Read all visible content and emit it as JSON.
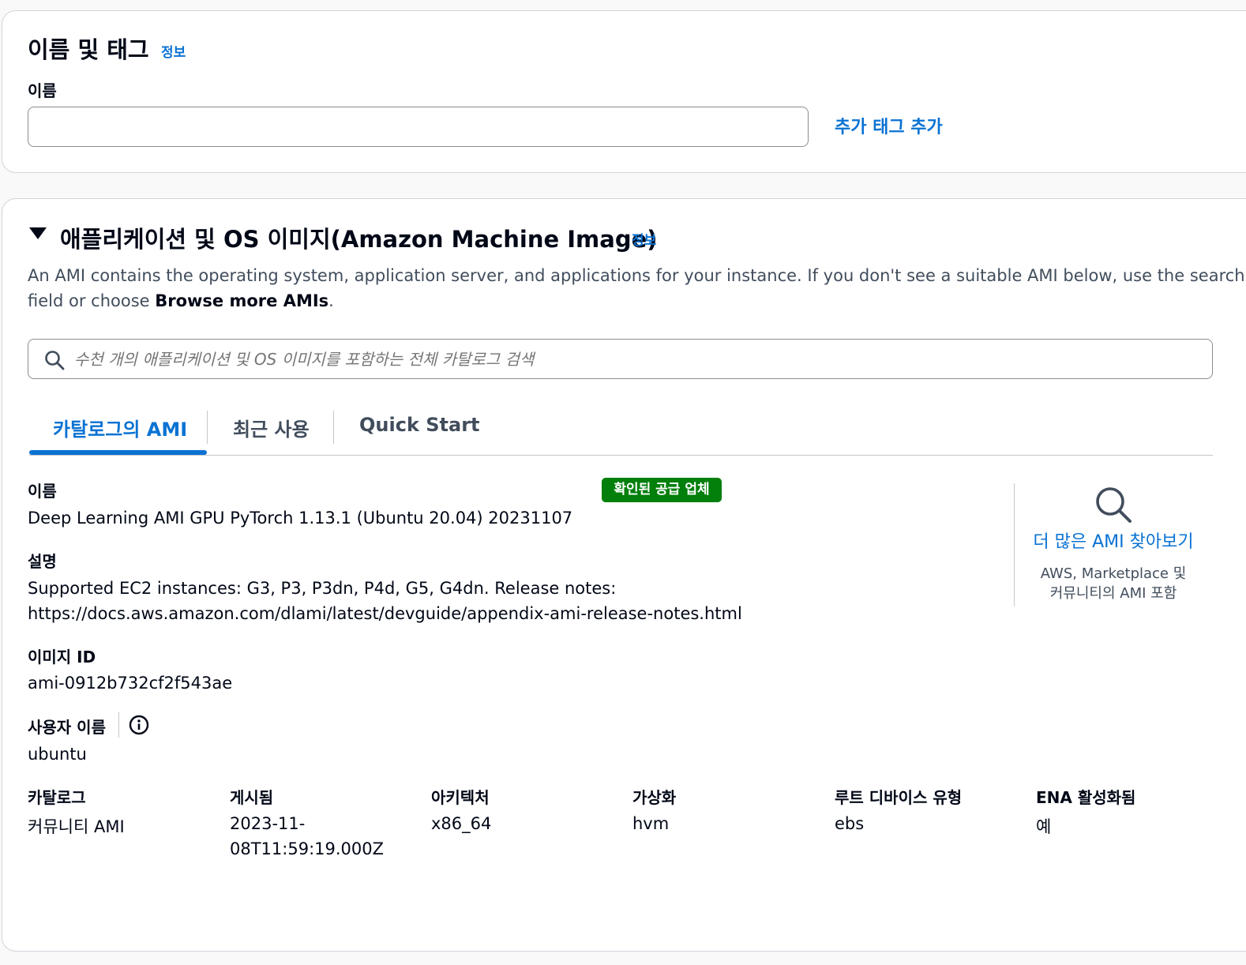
{
  "name_tags": {
    "title": "이름 및 태그",
    "info": "정보",
    "name_label": "이름",
    "name_value": "",
    "add_tag": "추가 태그 추가"
  },
  "ami_section": {
    "title": "애플리케이션 및 OS 이미지(Amazon Machine Image)",
    "info": "정보",
    "desc_part1": "An AMI contains the operating system, application server, and applications for your instance. If you don't see a suitable AMI below, use the search",
    "desc_part2": "field or choose ",
    "desc_bold": "Browse more AMIs",
    "desc_end": ".",
    "search_placeholder": "수천 개의 애플리케이션 및 OS 이미지를 포함하는 전체 카탈로그 검색",
    "tabs": [
      "카탈로그의 AMI",
      "최근 사용",
      "Quick Start"
    ],
    "active_tab": 0
  },
  "ami_details": {
    "name_label": "이름",
    "badge": "확인된 공급 업체",
    "name_value": "Deep Learning AMI GPU PyTorch 1.13.1 (Ubuntu 20.04) 20231107",
    "desc_label": "설명",
    "desc_line1": "Supported EC2 instances: G3, P3, P3dn, P4d, G5, G4dn. Release notes:",
    "desc_line2": "https://docs.aws.amazon.com/dlami/latest/devguide/appendix-ami-release-notes.html",
    "image_id_label": "이미지 ID",
    "image_id": "ami-0912b732cf2f543ae",
    "username_label": "사용자 이름",
    "username": "ubuntu",
    "meta": [
      {
        "label": "카탈로그",
        "value": "커뮤니티 AMI"
      },
      {
        "label": "게시됨",
        "value": "2023-11-",
        "value2": "08T11:59:19.000Z"
      },
      {
        "label": "아키텍처",
        "value": "x86_64"
      },
      {
        "label": "가상화",
        "value": "hvm"
      },
      {
        "label": "루트 디바이스 유형",
        "value": "ebs"
      },
      {
        "label": "ENA 활성화됨",
        "value": "예"
      }
    ]
  },
  "browse_more": {
    "link": "더 많은 AMI 찾아보기",
    "sub1": "AWS, Marketplace 및",
    "sub2": "커뮤니티의 AMI 포함"
  },
  "colors": {
    "link": "#0972d3",
    "badge": "#037f0c",
    "text": "#000716"
  }
}
